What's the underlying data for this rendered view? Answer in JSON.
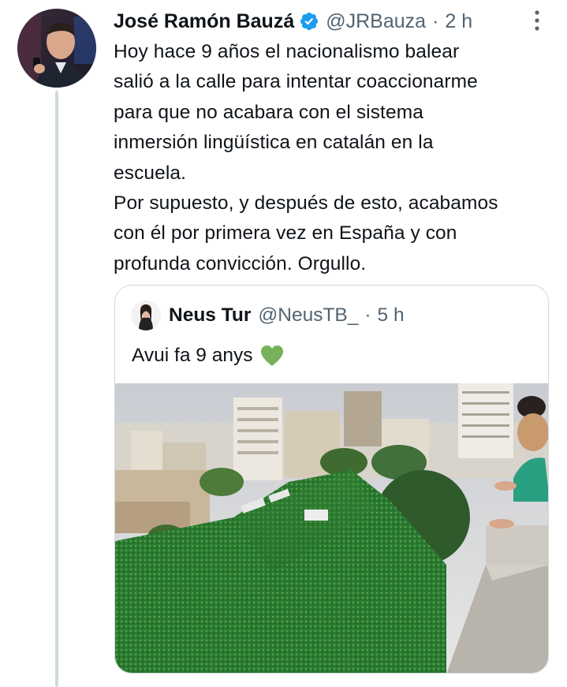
{
  "tweet": {
    "author_name": "José Ramón Bauzá",
    "handle": "@JRBauza",
    "separator": "·",
    "time": "2 h",
    "verified": true,
    "text_lines": [
      "Hoy hace 9 años el nacionalismo balear",
      "salió a la calle para intentar coaccionarme",
      "para que no acabara con el sistema",
      "inmersión lingüística en catalán en la",
      "escuela.",
      "Por supuesto, y después de esto, acabamos",
      "con él por primera vez en España y con",
      "profunda convicción. Orgullo."
    ],
    "icons": {
      "verified": "verified-badge-icon",
      "more": "more-options-icon"
    }
  },
  "quoted": {
    "author_name": "Neus Tur",
    "handle": "@NeusTB_",
    "separator": "·",
    "time": "5 h",
    "text": "Avui fa 9 anys",
    "emoji": "green-heart-icon"
  },
  "colors": {
    "text": "#0f1419",
    "secondary": "#536471",
    "verified": "#1d9bf0",
    "border": "#cfd9de",
    "heart": "#78b159"
  }
}
